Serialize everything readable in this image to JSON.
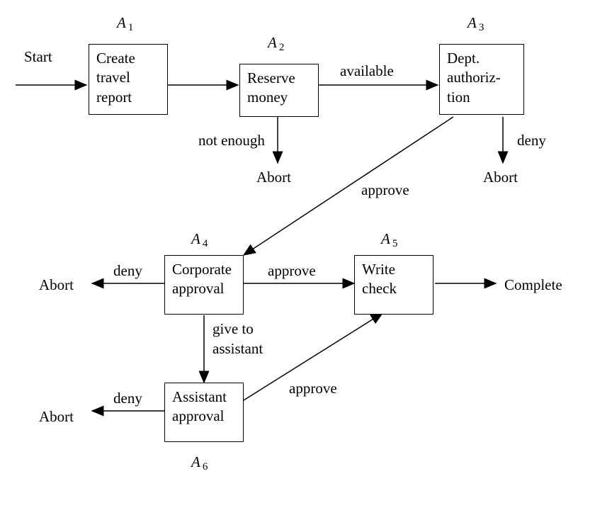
{
  "nodes": {
    "a1": {
      "id": "A",
      "sub": "1",
      "text": "Create\ntravel\nreport"
    },
    "a2": {
      "id": "A",
      "sub": "2",
      "text": "Reserve\nmoney"
    },
    "a3": {
      "id": "A",
      "sub": "3",
      "text": "Dept.\nauthoriz-\ntion"
    },
    "a4": {
      "id": "A",
      "sub": "4",
      "text": "Corporate\napproval"
    },
    "a5": {
      "id": "A",
      "sub": "5",
      "text": "Write\ncheck"
    },
    "a6": {
      "id": "A",
      "sub": "6",
      "text": "Assistant\napproval"
    }
  },
  "labels": {
    "start": "Start",
    "complete": "Complete",
    "available": "available",
    "not_enough": "not enough",
    "deny1": "deny",
    "approve1": "approve",
    "abort1": "Abort",
    "abort2": "Abort",
    "deny2": "deny",
    "abort3": "Abort",
    "approve2": "approve",
    "give_to": "give to",
    "assistant": "assistant",
    "deny3": "deny",
    "abort4": "Abort",
    "approve3": "approve"
  }
}
